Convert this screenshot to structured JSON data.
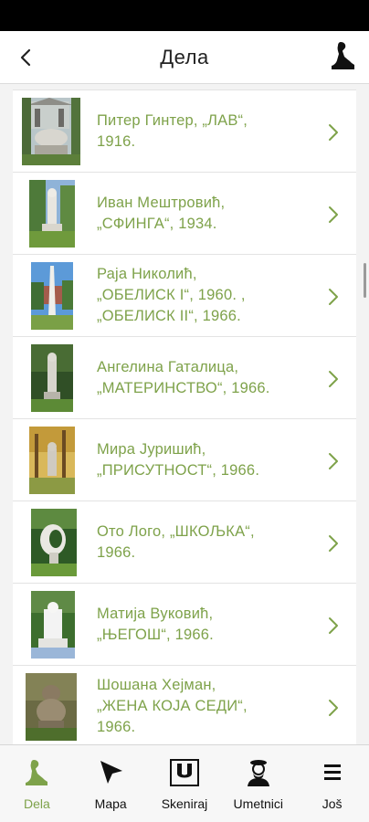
{
  "header": {
    "title": "Дела",
    "back_icon": "chevron-left-icon",
    "logo_icon": "sculpture-logo-icon"
  },
  "colors": {
    "accent": "#7ea24a",
    "text": "#222222",
    "divider": "#e3e3e3",
    "list_background": "#f3f3f3"
  },
  "works": [
    {
      "title": "Питер Гинтер, „ЛАВ“, 1916.",
      "lines": [
        "Питер Гинтер, „ЛАВ“,",
        "1916."
      ]
    },
    {
      "title": "Иван Мештровић, „СФИНГА“, 1934.",
      "lines": [
        "Иван Мештровић,",
        "„СФИНГА“, 1934."
      ]
    },
    {
      "title": "Раја Николић, „ОБЕЛИСК I“, 1960. , „ОБЕЛИСК II“, 1966.",
      "lines": [
        "Раја Николић,",
        "„ОБЕЛИСК I“, 1960. ,",
        "„ОБЕЛИСК II“, 1966."
      ]
    },
    {
      "title": "Ангелина Гаталица, „МАТЕРИНСТВО“, 1966.",
      "lines": [
        "Ангелина Гаталица,",
        "„МАТЕРИНСТВО“, 1966."
      ]
    },
    {
      "title": "Мира Јуришић, „ПРИСУТНОСТ“, 1966.",
      "lines": [
        "Мира Јуришић,",
        "„ПРИСУТНОСТ“, 1966."
      ]
    },
    {
      "title": "Ото Лого, „ШКОЉКА“, 1966.",
      "lines": [
        "Ото Лого, „ШКОЉКА“,",
        "1966."
      ]
    },
    {
      "title": "Матија Вуковић, „ЊЕГОШ“, 1966.",
      "lines": [
        "Матија Вуковић,",
        "„ЊЕГОШ“, 1966."
      ]
    },
    {
      "title": "Шошана Хејман, „ЖЕНА КОЈА СЕДИ“, 1966.",
      "lines": [
        "Шошана Хејман,",
        "„ЖЕНА КОЈА СЕДИ“,",
        "1966."
      ]
    }
  ],
  "tabs": [
    {
      "label": "Dela",
      "icon": "sculpture-icon",
      "active": true
    },
    {
      "label": "Mapa",
      "icon": "navigation-arrow-icon",
      "active": false
    },
    {
      "label": "Skeniraj",
      "icon": "scan-magnet-icon",
      "active": false
    },
    {
      "label": "Umetnici",
      "icon": "artist-icon",
      "active": false
    },
    {
      "label": "Još",
      "icon": "menu-icon",
      "active": false
    }
  ]
}
